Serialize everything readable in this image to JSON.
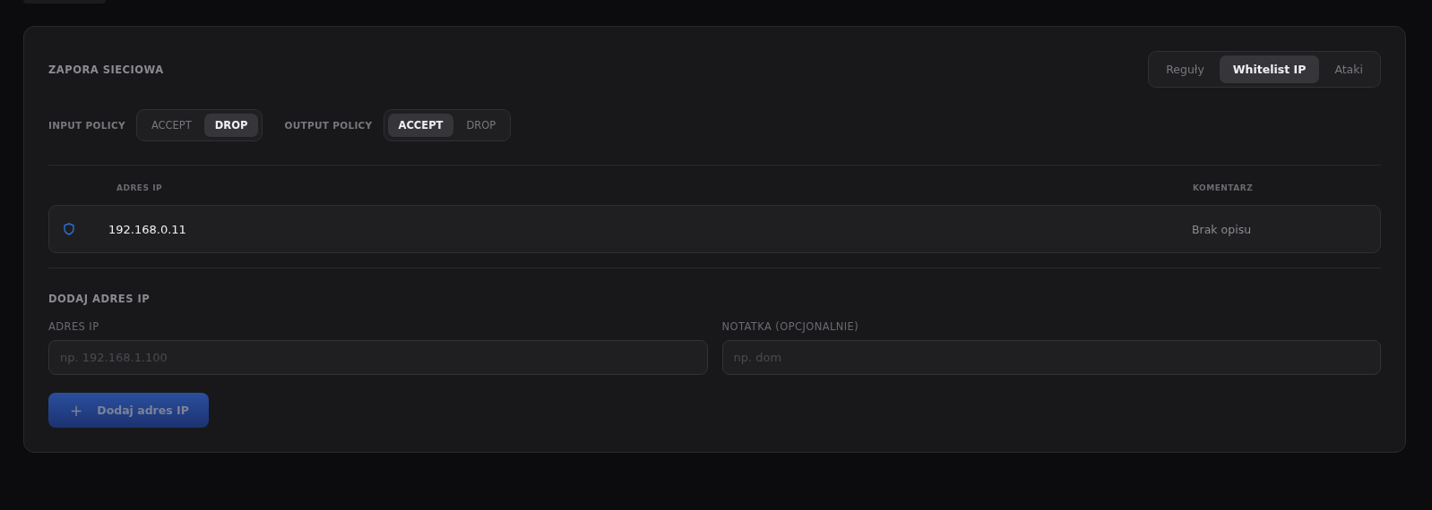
{
  "section": {
    "title": "ZAPORA SIECIOWA"
  },
  "tabs": [
    {
      "label": "Reguły",
      "selected": false
    },
    {
      "label": "Whitelist IP",
      "selected": true
    },
    {
      "label": "Ataki",
      "selected": false
    }
  ],
  "policies": [
    {
      "label": "INPUT POLICY",
      "options": [
        {
          "label": "ACCEPT",
          "selected": false
        },
        {
          "label": "DROP",
          "selected": true
        }
      ]
    },
    {
      "label": "OUTPUT POLICY",
      "options": [
        {
          "label": "ACCEPT",
          "selected": true
        },
        {
          "label": "DROP",
          "selected": false
        }
      ]
    }
  ],
  "table": {
    "columns": [
      "ADRES IP",
      "KOMENTARZ"
    ],
    "rows": [
      {
        "ip": "192.168.0.11",
        "comment": "Brak opisu"
      }
    ]
  },
  "add_form": {
    "title": "DODAJ ADRES IP",
    "fields": [
      {
        "label": "ADRES IP",
        "placeholder": "np. 192.168.1.100"
      },
      {
        "label": "NOTATKA (OPCJONALNIE)",
        "placeholder": "np. dom"
      }
    ],
    "button": {
      "icon": "+",
      "label": "Dodaj adres IP",
      "disabled": true
    }
  }
}
